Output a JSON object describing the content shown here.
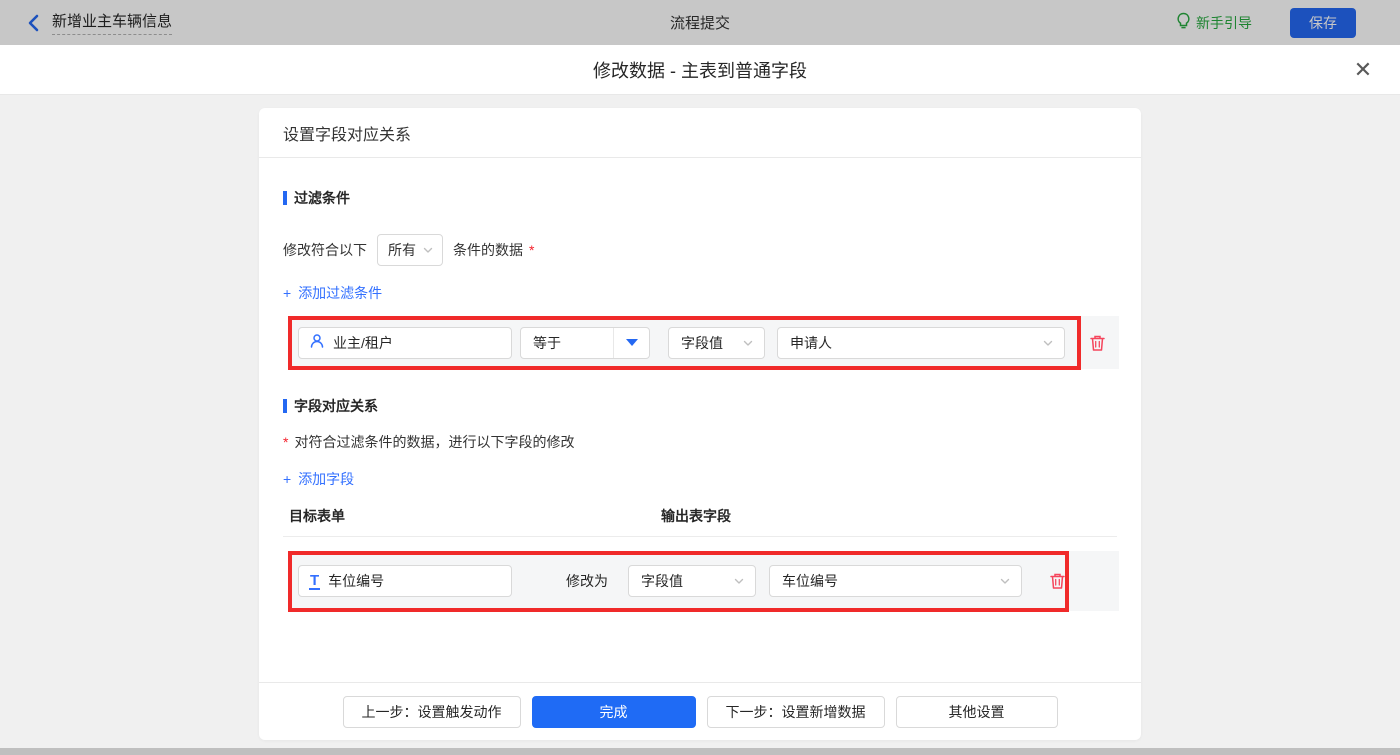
{
  "colors": {
    "accent_blue": "#3370ff",
    "primary_button": "#1f6bf5",
    "annotation_red": "#f02a2a",
    "trash_red": "#f5455c",
    "guide_green": "#27a93f",
    "section_bar": "#2468f2"
  },
  "topbar": {
    "back_title": "新增业主车辆信息",
    "center_title": "流程提交",
    "guide_label": "新手引导",
    "save_label": "保存"
  },
  "modal": {
    "title": "修改数据 - 主表到普通字段",
    "close_glyph": "✕"
  },
  "panel": {
    "header": "设置字段对应关系"
  },
  "filter": {
    "section_title": "过滤条件",
    "cond_prefix": "修改符合以下",
    "match_mode": "所有",
    "cond_suffix": "条件的数据",
    "required_mark": "*",
    "add_plus": "+",
    "add_label": "添加过滤条件",
    "row": {
      "field": "业主/租户",
      "operator": "等于",
      "value_type": "字段值",
      "value": "申请人"
    }
  },
  "mapping": {
    "section_title": "字段对应关系",
    "required_mark": "*",
    "hint": "对符合过滤条件的数据，进行以下字段的修改",
    "add_plus": "+",
    "add_label": "添加字段",
    "col_target": "目标表单",
    "col_output": "输出表字段",
    "row": {
      "field": "车位编号",
      "action": "修改为",
      "value_type": "字段值",
      "value": "车位编号",
      "t_icon_glyph": "T"
    }
  },
  "footer": {
    "prev_label": "上一步：设置触发动作",
    "done_label": "完成",
    "next_label": "下一步：设置新增数据",
    "other_label": "其他设置"
  }
}
